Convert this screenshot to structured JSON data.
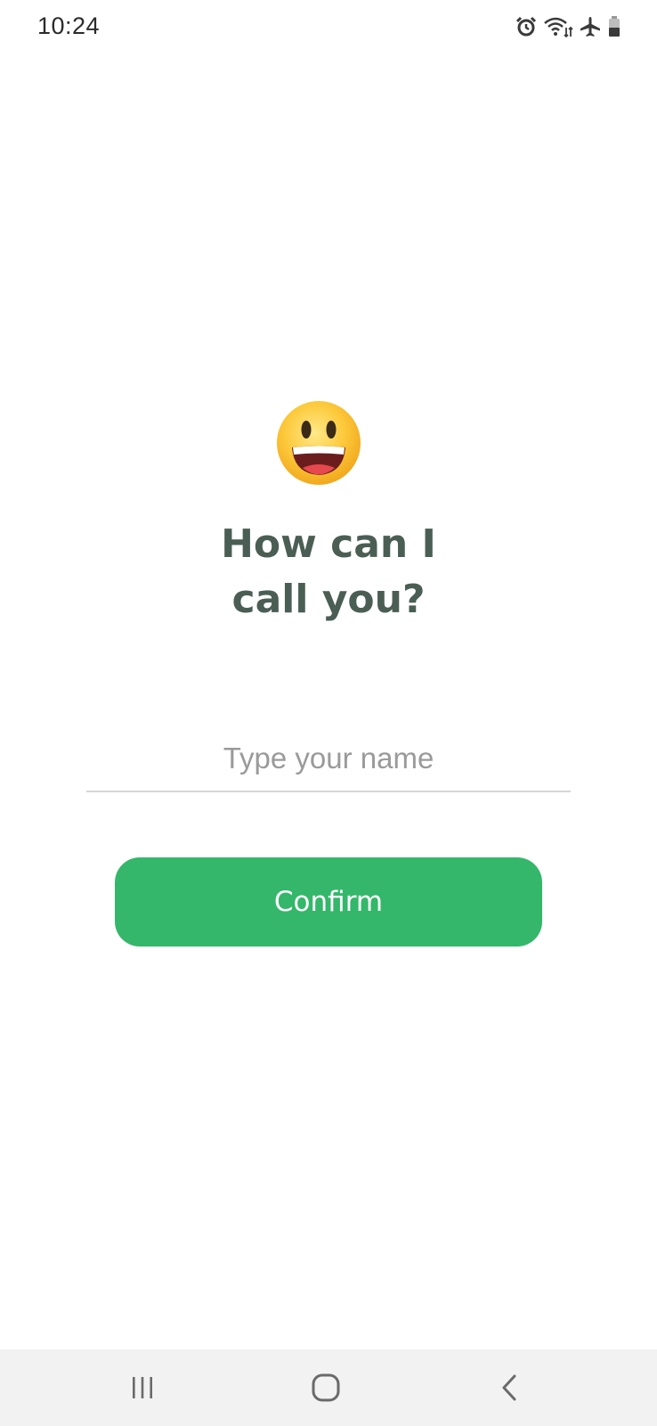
{
  "status_bar": {
    "time": "10:24",
    "icons": [
      "alarm-icon",
      "wifi-icon",
      "airplane-mode-icon",
      "battery-icon"
    ]
  },
  "main": {
    "emoji": "grinning-face-emoji",
    "heading_line1": "How can I",
    "heading_line2": "call you?",
    "name_input": {
      "value": "",
      "placeholder": "Type your name"
    },
    "confirm_label": "Confirm"
  },
  "nav_bar": {
    "buttons": [
      "recents-icon",
      "home-icon",
      "back-icon"
    ]
  },
  "colors": {
    "heading": "#4b5e56",
    "accent": "#34b76a",
    "nav_background": "#f2f2f2"
  }
}
